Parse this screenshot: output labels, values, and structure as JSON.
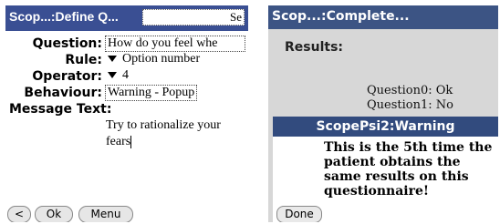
{
  "left": {
    "title": "Scop...:Define Q...",
    "title_field": "Se",
    "rows": [
      {
        "label": "Question:",
        "value": "How do you feel whe"
      },
      {
        "label": "Rule:",
        "value": "Option number"
      },
      {
        "label": "Operator:",
        "value": "4"
      },
      {
        "label": "Behaviour:",
        "value": "Warning - Popup"
      }
    ],
    "message_label": "Message Text:",
    "message_lines": [
      "Try to rationalize your",
      "fears"
    ],
    "buttons": {
      "back": "<",
      "ok": "Ok",
      "menu": "Menu"
    }
  },
  "right": {
    "title": "Scop...:Complete...",
    "results_label": "Results:",
    "results": [
      "Question0: Ok",
      "Question1: No"
    ],
    "dialog": {
      "title": "ScopePsi2:Warning",
      "lines": [
        "This is the 5th time the",
        "patient obtains the",
        "same results on this",
        "questionnaire!"
      ],
      "done_label": "Done"
    }
  }
}
